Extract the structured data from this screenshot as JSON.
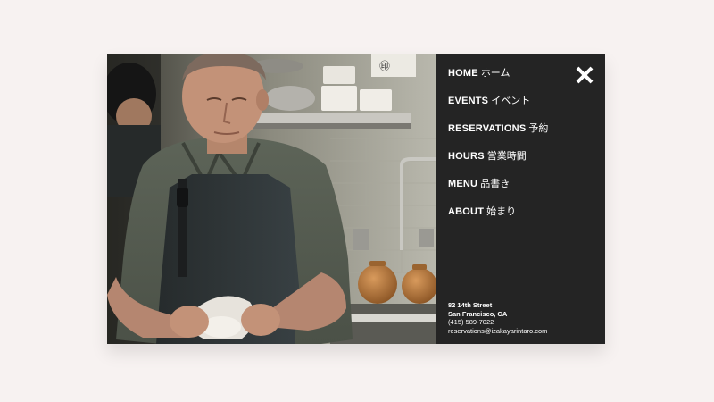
{
  "menu": {
    "close_icon": "close-icon",
    "items": [
      {
        "en": "HOME",
        "jp": "ホーム"
      },
      {
        "en": "EVENTS",
        "jp": "イベント"
      },
      {
        "en": "RESERVATIONS",
        "jp": "予約"
      },
      {
        "en": "HOURS",
        "jp": "営業時間"
      },
      {
        "en": "MENU",
        "jp": "品書き"
      },
      {
        "en": "ABOUT",
        "jp": "始まり"
      }
    ]
  },
  "contact": {
    "street": "82 14th Street",
    "city": "San Francisco, CA",
    "phone": "(415) 589-7022",
    "email": "reservations@izakayarintaro.com"
  },
  "colors": {
    "page_background": "#f7f2f1",
    "panel_background": "#242424",
    "text": "#ffffff"
  }
}
